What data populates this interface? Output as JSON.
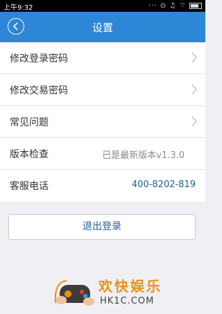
{
  "status_bar": {
    "time": "上午9:32",
    "icons": "··· ⊙ ♫ ⌔"
  },
  "nav": {
    "title": "设置"
  },
  "settings": [
    {
      "label": "修改登录密码"
    },
    {
      "label": "修改交易密码"
    },
    {
      "label": "常见问题"
    },
    {
      "label": "版本检查",
      "value": "已是最新版本v1.3.0"
    },
    {
      "label": "客服电话",
      "value": "400-8202-819"
    }
  ],
  "logout_label": "退出登录",
  "watermark": {
    "cn": "欢快娱乐",
    "en": "HK1C.COM"
  },
  "colors": {
    "nav": "#2e86d6",
    "phone": "#1d5f9e",
    "background": "#efeff4"
  }
}
